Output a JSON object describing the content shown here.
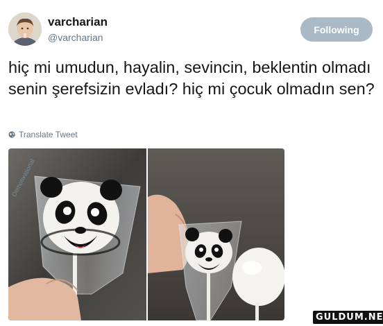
{
  "user": {
    "display_name": "varcharian",
    "handle": "@varcharian",
    "avatar_icon": "user-avatar"
  },
  "follow_button": {
    "label": "Following"
  },
  "tweet": {
    "text": "hiç mi umudun, hayalin, sevincin, beklentin olmadı senin şerefsizin evladı? hiç mi çocuk olmadın sen?"
  },
  "translate": {
    "label": "Translate Tweet",
    "icon": "globe-icon"
  },
  "media": {
    "photos": [
      {
        "name": "panda-lollipop-front",
        "wrapper_text": "Demotivational"
      },
      {
        "name": "panda-lollipop-back"
      }
    ]
  },
  "watermark": {
    "text": "GULDUM.NET"
  },
  "colors": {
    "text": "#14171a",
    "secondary": "#657786",
    "button_bg": "#a9b9c6",
    "background": "#ffffff"
  }
}
